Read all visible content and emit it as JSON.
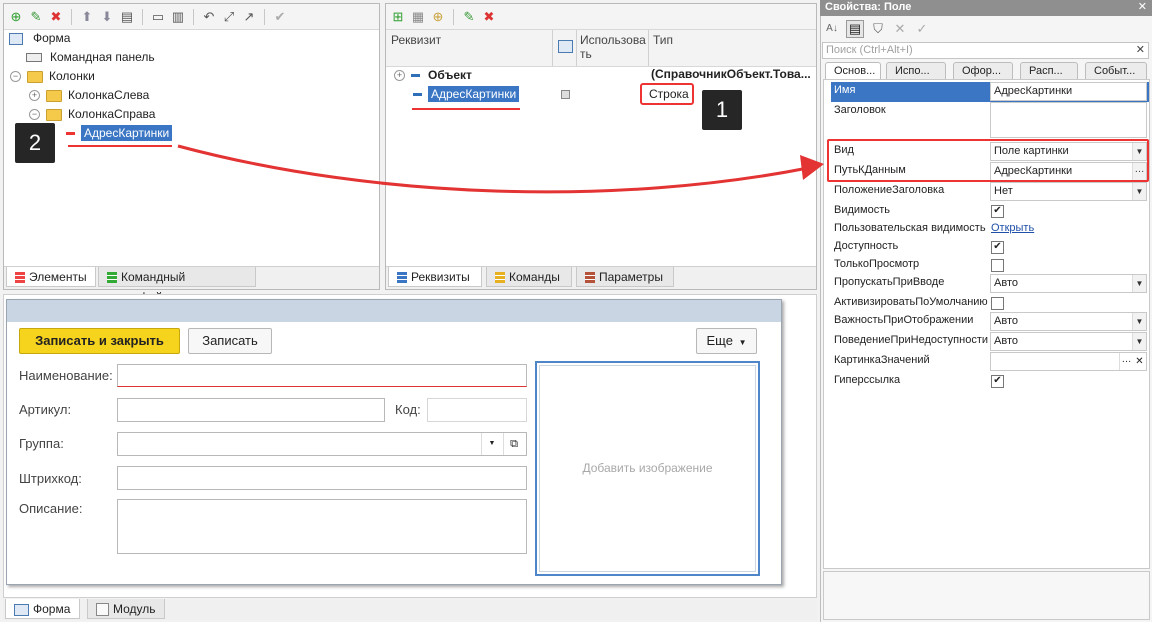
{
  "elements_panel": {
    "tree": [
      {
        "label": "Форма"
      },
      {
        "label": "Командная панель"
      },
      {
        "label": "Колонки"
      },
      {
        "label": "КолонкаСлева"
      },
      {
        "label": "КолонкаСправа"
      },
      {
        "label": "АдресКартинки"
      }
    ],
    "tabs": [
      "Элементы",
      "Командный интерфейс"
    ]
  },
  "attributes_panel": {
    "columns": [
      "Реквизит",
      "Использова ть",
      "Тип"
    ],
    "rows": [
      {
        "name": "Объект",
        "type": "(СправочникОбъект.Това..."
      },
      {
        "name": "АдресКартинки",
        "type": "Строка"
      }
    ],
    "tabs": [
      "Реквизиты",
      "Команды",
      "Параметры"
    ]
  },
  "badges": {
    "one": "1",
    "two": "2"
  },
  "form_preview": {
    "save_close": "Записать и закрыть",
    "save": "Записать",
    "more": "Еще",
    "labels": {
      "name": "Наименование:",
      "article": "Артикул:",
      "code": "Код:",
      "group": "Группа:",
      "barcode": "Штрихкод:",
      "description": "Описание:"
    },
    "image_placeholder": "Добавить изображение"
  },
  "bottom_tabs": [
    "Форма",
    "Модуль"
  ],
  "properties": {
    "title": "Свойства: Поле",
    "search_placeholder": "Поиск (Ctrl+Alt+I)",
    "tabs": [
      "Основ...",
      "Испо...",
      "Офор...",
      "Расп...",
      "Событ..."
    ],
    "rows": [
      {
        "label": "Имя",
        "value": "АдресКартинки"
      },
      {
        "label": "Заголовок",
        "value": ""
      },
      {
        "label": "Вид",
        "value": "Поле картинки"
      },
      {
        "label": "ПутьКДанным",
        "value": "АдресКартинки"
      },
      {
        "label": "ПоложениеЗаголовка",
        "value": "Нет"
      },
      {
        "label": "Видимость",
        "value": "checked"
      },
      {
        "label": "Пользовательская видимость",
        "value": "Открыть"
      },
      {
        "label": "Доступность",
        "value": "checked"
      },
      {
        "label": "ТолькоПросмотр",
        "value": "unchecked"
      },
      {
        "label": "ПропускатьПриВводе",
        "value": "Авто"
      },
      {
        "label": "АктивизироватьПоУмолчанию",
        "value": "unchecked"
      },
      {
        "label": "ВажностьПриОтображении",
        "value": "Авто"
      },
      {
        "label": "ПоведениеПриНедоступности",
        "value": "Авто"
      },
      {
        "label": "КартинкаЗначений",
        "value": ""
      },
      {
        "label": "Гиперссылка",
        "value": "checked"
      }
    ]
  },
  "colors": {
    "accent_red": "#e33333",
    "highlight_blue": "#3a76c4",
    "primary_yellow": "#f6d31d"
  }
}
